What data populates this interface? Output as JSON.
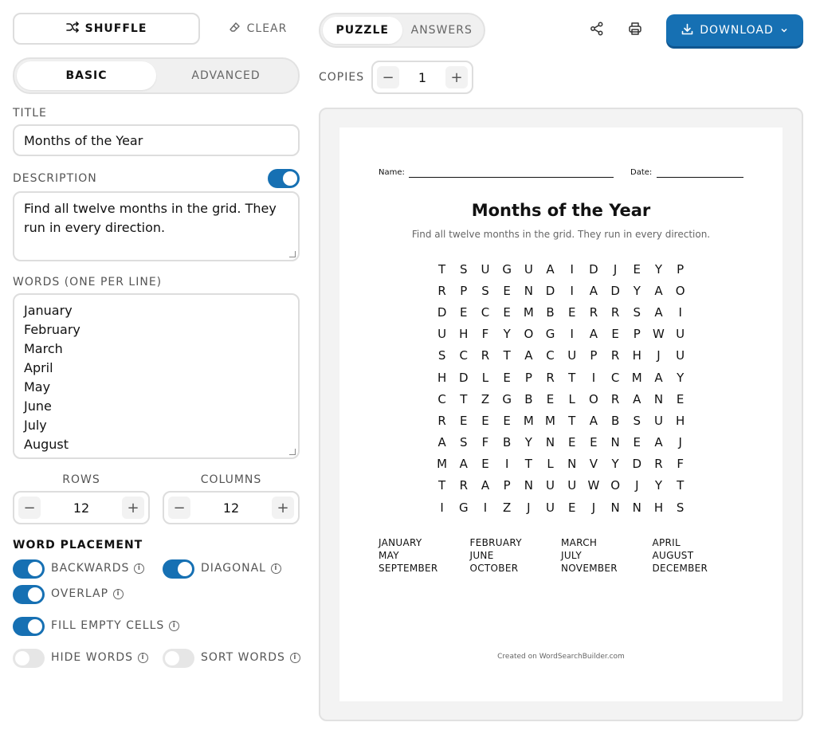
{
  "toolbar": {
    "shuffle_label": "SHUFFLE",
    "clear_label": "CLEAR",
    "download_label": "DOWNLOAD"
  },
  "mode_tabs": [
    "BASIC",
    "ADVANCED"
  ],
  "view_tabs": [
    "PUZZLE",
    "ANSWERS"
  ],
  "copies": {
    "label": "COPIES",
    "value": "1"
  },
  "form": {
    "title_label": "TITLE",
    "title_value": "Months of the Year",
    "description_label": "DESCRIPTION",
    "description_enabled": true,
    "description_value": "Find all twelve months in the grid. They run in every direction.",
    "words_label": "WORDS (ONE PER LINE)",
    "words_lines": [
      "January",
      "February",
      "March",
      "April",
      "May",
      "June",
      "July",
      "August"
    ],
    "rows_label": "ROWS",
    "rows_value": "12",
    "columns_label": "COLUMNS",
    "columns_value": "12",
    "placement_label": "WORD PLACEMENT",
    "options": [
      {
        "label": "BACKWARDS",
        "on": true
      },
      {
        "label": "DIAGONAL",
        "on": true
      },
      {
        "label": "OVERLAP",
        "on": true
      },
      {
        "label": "FILL EMPTY CELLS",
        "on": true
      },
      {
        "label": "HIDE WORDS",
        "on": false
      },
      {
        "label": "SORT WORDS",
        "on": false
      }
    ]
  },
  "sheet": {
    "name_label": "Name:",
    "date_label": "Date:",
    "title": "Months of the Year",
    "description": "Find all twelve months in the grid. They run in every direction.",
    "grid": [
      "TSUGUAIDJEYP",
      "RPSENDIADYAO",
      "DECEMBERRSAI",
      "UHFYOGIAEPWU",
      "SCRTACUPRHJU",
      "HDLEPRTICMAY",
      "CTZGBELORANE",
      "REEEMMTABSUH",
      "ASFBYNEENEAJ",
      "MAEITLNVYDRF",
      "TRAPNUUWOJYT",
      "IGIZJUEJNNHS"
    ],
    "word_list": [
      "JANUARY",
      "FEBRUARY",
      "MARCH",
      "APRIL",
      "MAY",
      "JUNE",
      "JULY",
      "AUGUST",
      "SEPTEMBER",
      "OCTOBER",
      "NOVEMBER",
      "DECEMBER"
    ],
    "credit": "Created on WordSearchBuilder.com"
  },
  "colors": {
    "accent": "#1670b3",
    "border": "#dddddd",
    "muted": "#555555"
  }
}
